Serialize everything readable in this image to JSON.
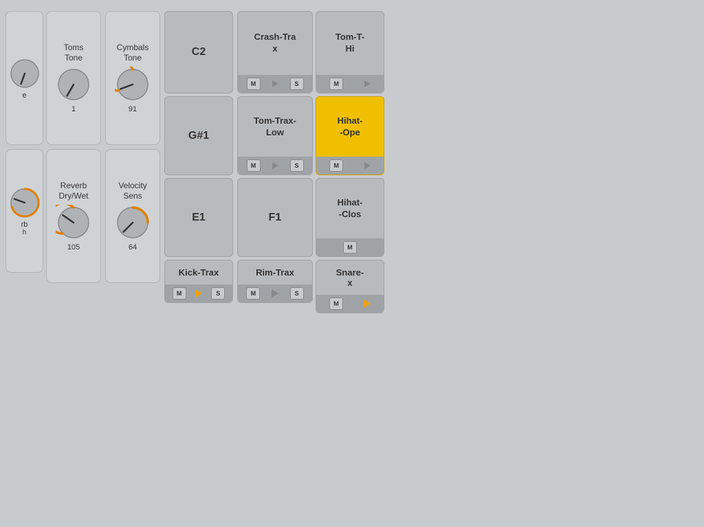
{
  "page": {
    "bg_color": "#b8bbbe"
  },
  "left_panel": {
    "knob_rows": [
      [
        {
          "id": "toms-tone",
          "label": "Toms\nTone",
          "value": "1",
          "color": "#333",
          "angle": 210,
          "orange": false
        },
        {
          "id": "cymbals-tone",
          "label": "Cymbals\nTone",
          "value": "91",
          "color": "#e08000",
          "angle": 250,
          "orange": true
        }
      ],
      [
        {
          "id": "reverb-drywet",
          "label": "Reverb\nDry/Wet",
          "value": "105",
          "color": "#e08000",
          "angle": 300,
          "orange": true
        },
        {
          "id": "velocity-sens",
          "label": "Velocity\nSens",
          "value": "64",
          "color": "#e08000",
          "angle": 230,
          "orange": true
        }
      ]
    ]
  },
  "middle_notes": [
    {
      "id": "note-c2",
      "label": "C2"
    },
    {
      "id": "note-g1",
      "label": "G#1"
    },
    {
      "id": "note-e1",
      "label": "E1"
    }
  ],
  "bottom_tracks": [
    {
      "id": "kick-trax",
      "label": "Kick-Trax",
      "has_m": true,
      "has_play": true,
      "has_s": true,
      "play_color": "yellow"
    },
    {
      "id": "rim-trax",
      "label": "Rim-Trax",
      "has_m": true,
      "has_play": true,
      "has_s": true,
      "play_color": "gray"
    },
    {
      "id": "snare-x",
      "label": "Snare-\nx",
      "has_m": true,
      "has_play": true,
      "has_s": false,
      "play_color": "yellow"
    }
  ],
  "right_tracks": [
    {
      "id": "crash-trax",
      "label": "Crash-Tra\nx",
      "highlighted": false,
      "top_note": "",
      "mid_note": "Tom-Trax-\nLow",
      "mid_highlighted": false,
      "has_top_transport": true,
      "has_mid_transport": true,
      "bottom_label": "F1"
    },
    {
      "id": "tom-trax-hi",
      "label": "Tom-T-\nHi",
      "highlighted": false,
      "mid_note": "Hihat-\n-Ope",
      "mid_highlighted": true,
      "has_top_transport": true,
      "has_mid_transport": true,
      "bottom_label": "Hihat-\n-Clos"
    }
  ],
  "labels": {
    "m": "M",
    "s": "S"
  }
}
